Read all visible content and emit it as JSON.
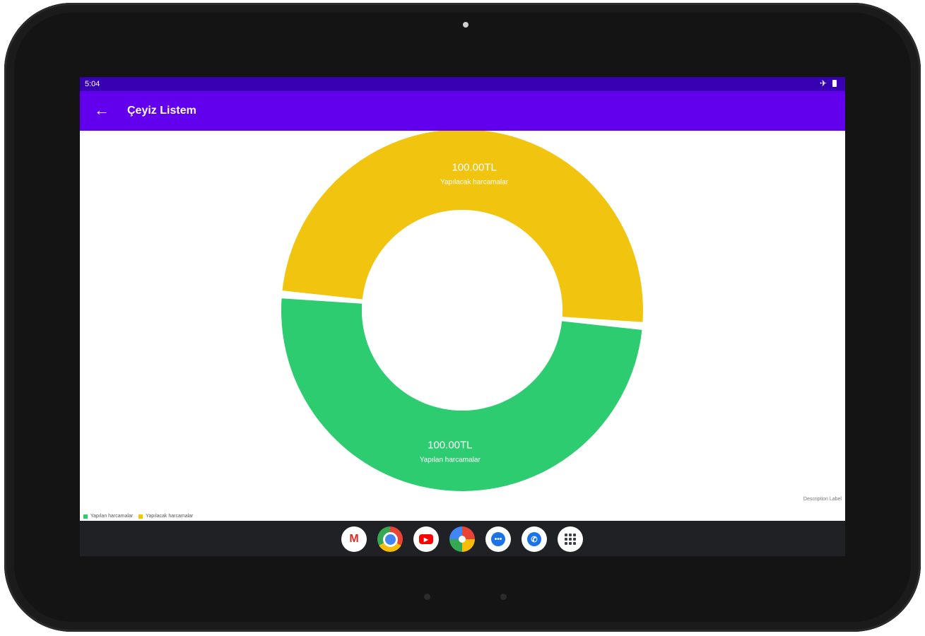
{
  "status": {
    "time": "5:04",
    "icons": [
      "airplane-icon",
      "battery-icon"
    ]
  },
  "appbar": {
    "title": "Çeyiz Listem",
    "back_icon": "arrow-back-icon"
  },
  "colors": {
    "status_bar": "#3700b3",
    "app_bar": "#6200ee",
    "pending": "#f1c40f",
    "done": "#2ecc71",
    "nav": "#202124"
  },
  "chart_data": {
    "type": "pie",
    "style": "donut",
    "slices": [
      {
        "label": "Yapılacak harcamalar",
        "value": 100.0,
        "display": "100.00TL",
        "color": "#f1c40f"
      },
      {
        "label": "Yapılan harcamalar",
        "value": 100.0,
        "display": "100.00TL",
        "color": "#2ecc71"
      }
    ],
    "legend": [
      {
        "label": "Yapılan harcamalar",
        "color": "#2ecc71"
      },
      {
        "label": "Yapılacak harcamalar",
        "color": "#f1c40f"
      }
    ],
    "legend_position": "bottom-left",
    "description": "Description Label"
  },
  "dock": {
    "apps": [
      {
        "name": "gmail-icon",
        "label": "M"
      },
      {
        "name": "chrome-icon",
        "label": ""
      },
      {
        "name": "youtube-icon",
        "label": "▶"
      },
      {
        "name": "photos-icon",
        "label": ""
      },
      {
        "name": "messages-icon",
        "label": "•••"
      },
      {
        "name": "phone-icon",
        "label": "✆"
      },
      {
        "name": "app-drawer-icon",
        "label": ""
      }
    ]
  }
}
